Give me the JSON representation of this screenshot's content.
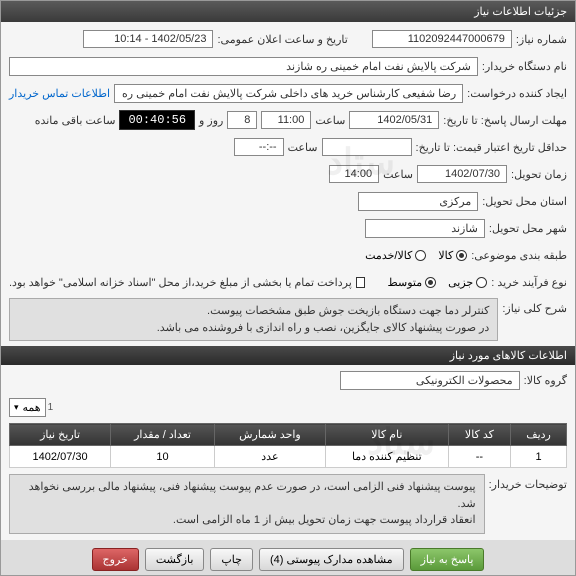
{
  "titlebar": "جزئیات اطلاعات نیاز",
  "labels": {
    "reqNo": "شماره نیاز:",
    "announceDate": "تاریخ و ساعت اعلان عمومی:",
    "buyerOrg": "نام دستگاه خریدار:",
    "creator": "ایجاد کننده درخواست:",
    "contactInfo": "اطلاعات تماس خریدار",
    "deadline": "مهلت ارسال پاسخ: تا تاریخ:",
    "hour": "ساعت",
    "days": "روز و",
    "remaining": "ساعت باقی مانده",
    "validityExpiry": "حداقل تاریخ اعتبار قیمت: تا تاریخ:",
    "deliveryDate": "زمان تحویل:",
    "deliveryProvince": "استان محل تحویل:",
    "deliveryCity": "شهر محل تحویل:",
    "categoryType": "طبقه بندی موضوعی:",
    "purchaseType": "نوع فرآیند خرید :",
    "partial": "جزیی",
    "medium": "متوسط",
    "goods": "کالا",
    "service": "کالا/خدمت",
    "paymentNote": "پرداخت تمام یا بخشی از مبلغ خرید،از محل \"اسناد خزانه اسلامی\" خواهد بود.",
    "reqDesc": "شرح کلی نیاز:",
    "goodsGroup": "گروه کالا:",
    "buyerNotes": "توضیحات خریدار:"
  },
  "values": {
    "reqNo": "1102092447000679",
    "announceDate": "1402/05/23 - 10:14",
    "buyerOrg": "شرکت پالایش نفت امام خمینی  ره  شازند",
    "creator": "رضا  شفیعی  کارشناس خرید های داخلی  شرکت پالایش نفت امام خمینی  ره",
    "deadlineDate": "1402/05/31",
    "deadlineTime": "11:00",
    "daysLeft": "8",
    "countdown": "00:40:56",
    "validityTime": "--:--",
    "deliveryDate": "1402/07/30",
    "deliveryTime": "14:00",
    "province": "مرکزی",
    "city": "شازند",
    "descLine1": "کنترلر دما جهت دستگاه بازیخت جوش طبق مشخصات پیوست.",
    "descLine2": "در صورت پیشنهاد کالای جایگزین، نصب و راه اندازی با فروشنده می باشد.",
    "goodsGroup": "محصولات الکترونیکی",
    "notesLine1": "پیوست پیشنهاد فنی الزامی است، در صورت عدم پیوست پیشنهاد فنی، پیشنهاد مالی بررسی نخواهد شد.",
    "notesLine2": "انعقاد قرارداد پیوست جهت زمان تحویل بیش از 1 ماه الزامی است."
  },
  "sectionHeader": "اطلاعات کالاهای مورد نیاز",
  "table": {
    "headers": [
      "ردیف",
      "کد کالا",
      "نام کالا",
      "واحد شمارش",
      "تعداد / مقدار",
      "تاریخ نیاز"
    ],
    "rows": [
      {
        "idx": "1",
        "code": "--",
        "name": "تنظیم کننده دما",
        "unit": "عدد",
        "qty": "10",
        "date": "1402/07/30"
      }
    ]
  },
  "scroll": {
    "label": "همه",
    "count": "1"
  },
  "buttons": {
    "respond": "پاسخ به نیاز",
    "attachments": "مشاهده مدارک پیوستی (4)",
    "print": "چاپ",
    "back": "بازگشت",
    "exit": "خروج"
  },
  "watermark": "ستاد"
}
